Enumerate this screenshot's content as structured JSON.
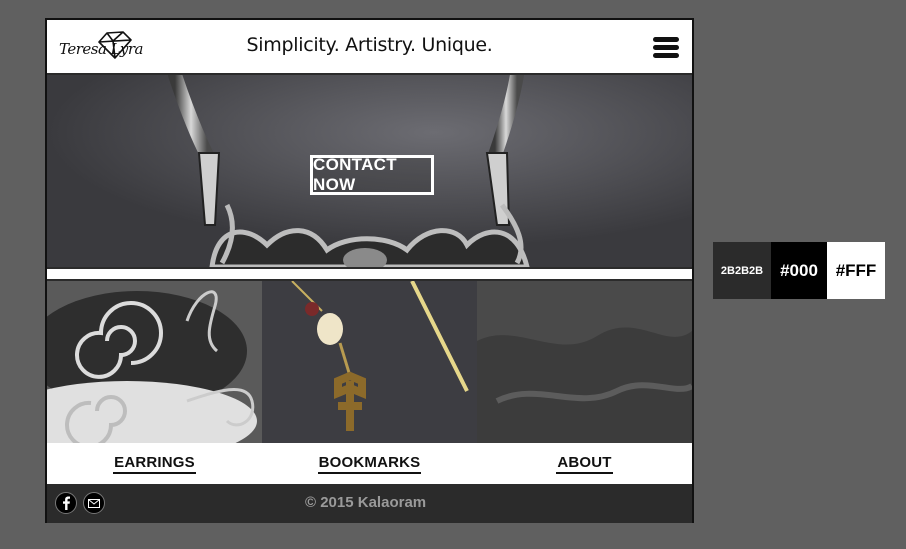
{
  "header": {
    "logo_text": "Teresa Lyra",
    "tagline": "Simplicity. Artistry. Unique.",
    "menu_icon": "hamburger-menu-icon"
  },
  "hero": {
    "contact_label": "CONTACT NOW"
  },
  "categories": [
    {
      "label": "EARRINGS"
    },
    {
      "label": "BOOKMARKS"
    },
    {
      "label": "ABOUT"
    }
  ],
  "footer": {
    "copyright": "© 2015 Kalaoram",
    "social_icons": [
      "facebook-icon",
      "email-icon"
    ]
  },
  "palette": [
    {
      "label": "2B2B2B",
      "color": "#2B2B2B",
      "text_color": "#FFFFFF"
    },
    {
      "label": "#000",
      "color": "#000000",
      "text_color": "#FFFFFF"
    },
    {
      "label": "#FFF",
      "color": "#FFFFFF",
      "text_color": "#000000"
    }
  ]
}
